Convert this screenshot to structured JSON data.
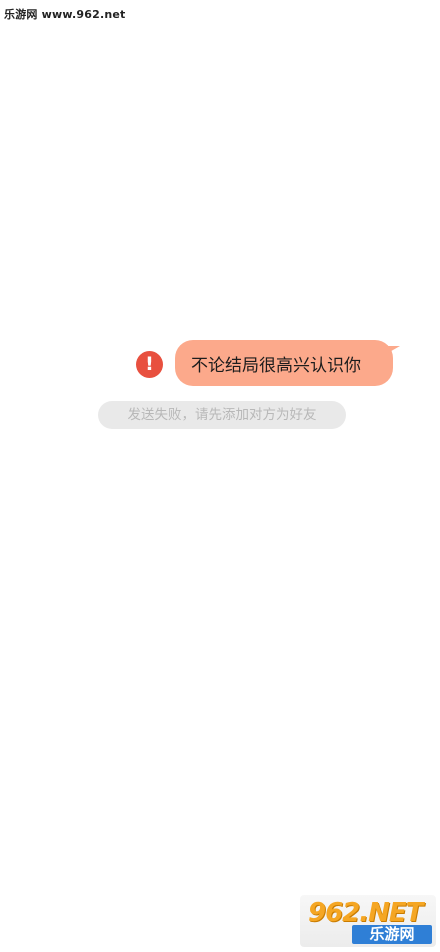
{
  "watermark": {
    "top_text": "乐游网 www.962.net",
    "logo_top": "962.NET",
    "logo_bottom": "乐游网"
  },
  "chat": {
    "error_icon": "exclamation-icon",
    "error_glyph": "!",
    "message_text": "不论结局很高兴认识你",
    "fail_notice": "发送失败，请先添加对方为好友"
  },
  "colors": {
    "bubble": "#fca98b",
    "error": "#e8503f",
    "notice_bg": "#e9e9e9",
    "notice_text": "#b8b8b8"
  }
}
